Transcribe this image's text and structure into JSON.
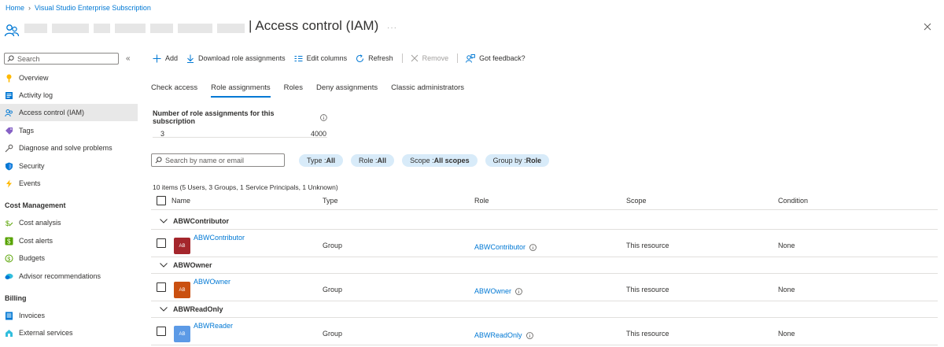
{
  "breadcrumb": [
    "Home",
    "Visual Studio Enterprise Subscription"
  ],
  "header": {
    "title": "Access control (IAM)",
    "more": "···"
  },
  "sidebar": {
    "search_placeholder": "Search",
    "collapse": "«",
    "items_top": [
      {
        "label": "Overview",
        "icon": "key-icon"
      },
      {
        "label": "Activity log",
        "icon": "activity-log-icon"
      },
      {
        "label": "Access control (IAM)",
        "icon": "people-icon",
        "active": true
      },
      {
        "label": "Tags",
        "icon": "tag-icon"
      },
      {
        "label": "Diagnose and solve problems",
        "icon": "wrench-icon"
      },
      {
        "label": "Security",
        "icon": "shield-icon"
      },
      {
        "label": "Events",
        "icon": "lightning-icon"
      }
    ],
    "section_cost": "Cost Management",
    "items_cost": [
      {
        "label": "Cost analysis",
        "icon": "cost-analysis-icon"
      },
      {
        "label": "Cost alerts",
        "icon": "cost-alerts-icon"
      },
      {
        "label": "Budgets",
        "icon": "budgets-icon"
      },
      {
        "label": "Advisor recommendations",
        "icon": "advisor-icon"
      }
    ],
    "section_billing": "Billing",
    "items_billing": [
      {
        "label": "Invoices",
        "icon": "invoices-icon"
      },
      {
        "label": "External services",
        "icon": "external-services-icon"
      }
    ]
  },
  "toolbar": {
    "add": "Add",
    "download": "Download role assignments",
    "edit_columns": "Edit columns",
    "refresh": "Refresh",
    "remove": "Remove",
    "feedback": "Got feedback?"
  },
  "tabs": [
    "Check access",
    "Role assignments",
    "Roles",
    "Deny assignments",
    "Classic administrators"
  ],
  "active_tab": "Role assignments",
  "quota": {
    "label": "Number of role assignments for this subscription",
    "current": "3",
    "max": "4000"
  },
  "filters": {
    "search_placeholder": "Search by name or email",
    "pills": [
      {
        "key": "Type : ",
        "value": "All"
      },
      {
        "key": "Role : ",
        "value": "All"
      },
      {
        "key": "Scope : ",
        "value": "All scopes"
      },
      {
        "key": "Group by : ",
        "value": "Role"
      }
    ]
  },
  "count_text": "10 items (5 Users, 3 Groups, 1 Service Principals, 1 Unknown)",
  "columns": {
    "name": "Name",
    "type": "Type",
    "role": "Role",
    "scope": "Scope",
    "condition": "Condition"
  },
  "groups": [
    {
      "title": "ABWContributor",
      "row": {
        "initials": "AB",
        "name": "ABWContributor",
        "type": "Group",
        "role": "ABWContributor",
        "scope": "This resource",
        "condition": "None",
        "color": "#a4262c"
      }
    },
    {
      "title": "ABWOwner",
      "row": {
        "initials": "AB",
        "name": "ABWOwner",
        "type": "Group",
        "role": "ABWOwner",
        "scope": "This resource",
        "condition": "None",
        "color": "#ca5010"
      }
    },
    {
      "title": "ABWReadOnly",
      "row": {
        "initials": "AB",
        "name": "ABWReader",
        "type": "Group",
        "role": "ABWReadOnly",
        "scope": "This resource",
        "condition": "None",
        "color": "#5c9ae6"
      }
    }
  ]
}
